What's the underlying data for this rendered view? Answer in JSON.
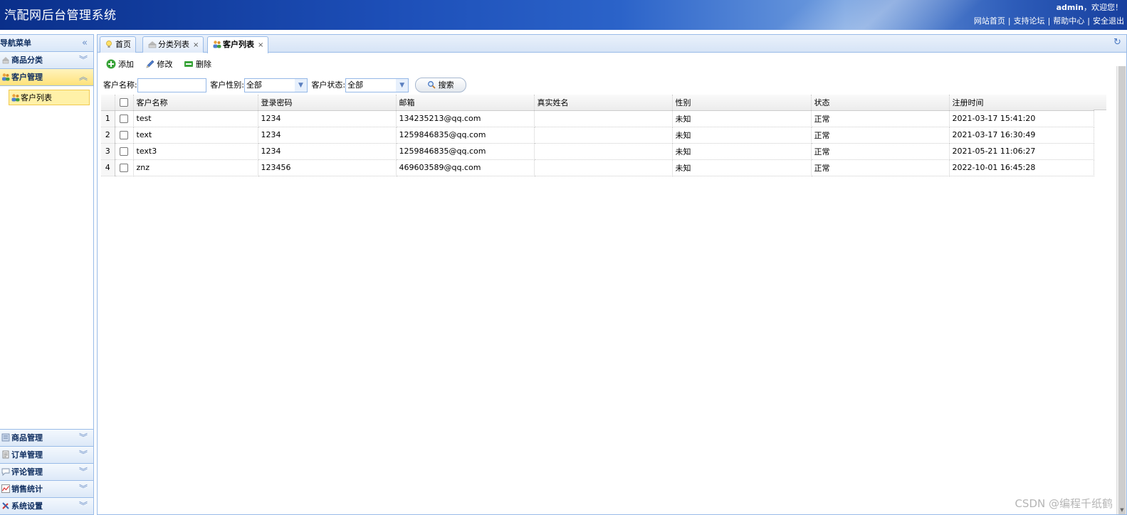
{
  "header": {
    "title": "汽配网后台管理系统",
    "user": "admin",
    "welcome_suffix": "，欢迎您！",
    "links": [
      "网站首页",
      "支持论坛",
      "帮助中心",
      "安全退出"
    ],
    "separator": "|"
  },
  "sidebar": {
    "title": "导航菜单",
    "collapse_icon": "double-chevron-left-icon",
    "panels_top": [
      {
        "label": "商品分类",
        "icon": "category-icon",
        "active": false
      },
      {
        "label": "客户管理",
        "icon": "users-icon",
        "active": true
      }
    ],
    "active_subitem": {
      "label": "客户列表",
      "icon": "users-icon"
    },
    "panels_bottom": [
      {
        "label": "商品管理",
        "icon": "goods-icon"
      },
      {
        "label": "订单管理",
        "icon": "order-icon"
      },
      {
        "label": "评论管理",
        "icon": "comment-icon"
      },
      {
        "label": "销售统计",
        "icon": "chart-icon"
      },
      {
        "label": "系统设置",
        "icon": "settings-icon"
      }
    ]
  },
  "tabs": [
    {
      "label": "首页",
      "icon": "bulb-icon",
      "closable": false,
      "active": false
    },
    {
      "label": "分类列表",
      "icon": "category-icon",
      "closable": true,
      "active": false
    },
    {
      "label": "客户列表",
      "icon": "users-icon",
      "closable": true,
      "active": true
    }
  ],
  "toolbar": {
    "add_label": "添加",
    "edit_label": "修改",
    "delete_label": "删除"
  },
  "search": {
    "name_label": "客户名称:",
    "name_value": "",
    "gender_label": "客户性别:",
    "gender_value": "全部",
    "status_label": "客户状态:",
    "status_value": "全部",
    "button_label": "搜索"
  },
  "grid": {
    "columns": [
      "客户名称",
      "登录密码",
      "邮箱",
      "真实姓名",
      "性别",
      "状态",
      "注册时间"
    ],
    "rows": [
      {
        "n": "1",
        "name": "test",
        "password": "1234",
        "email": "134235213@qq.com",
        "realname": "",
        "gender": "未知",
        "status": "正常",
        "time": "2021-03-17 15:41:20"
      },
      {
        "n": "2",
        "name": "text",
        "password": "1234",
        "email": "1259846835@qq.com",
        "realname": "",
        "gender": "未知",
        "status": "正常",
        "time": "2021-03-17 16:30:49"
      },
      {
        "n": "3",
        "name": "text3",
        "password": "1234",
        "email": "1259846835@qq.com",
        "realname": "",
        "gender": "未知",
        "status": "正常",
        "time": "2021-05-21 11:06:27"
      },
      {
        "n": "4",
        "name": "znz",
        "password": "123456",
        "email": "469603589@qq.com",
        "realname": "",
        "gender": "未知",
        "status": "正常",
        "time": "2022-10-01 16:45:28"
      }
    ]
  },
  "watermark": "CSDN @编程千纸鹤",
  "colors": {
    "header_dark": "#0a2f8a",
    "border": "#99bbe8",
    "active_panel": "#ffe27a",
    "active_subitem": "#fff1a8"
  }
}
